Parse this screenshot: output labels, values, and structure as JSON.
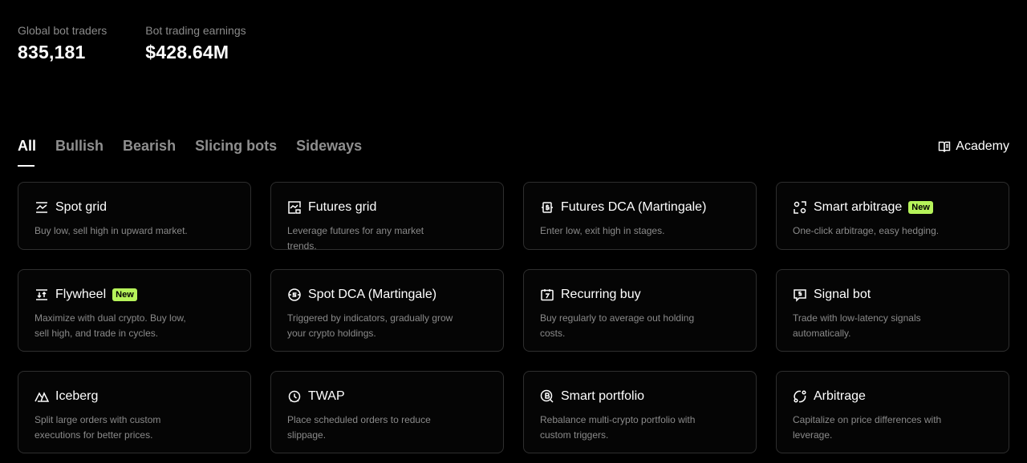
{
  "stats": [
    {
      "label": "Global bot traders",
      "value": "835,181"
    },
    {
      "label": "Bot trading earnings",
      "value": "$428.64M"
    }
  ],
  "tabs": [
    {
      "label": "All",
      "active": true
    },
    {
      "label": "Bullish",
      "active": false
    },
    {
      "label": "Bearish",
      "active": false
    },
    {
      "label": "Slicing bots",
      "active": false
    },
    {
      "label": "Sideways",
      "active": false
    }
  ],
  "academy": {
    "label": "Academy",
    "icon": "book-icon"
  },
  "badge_color": "#b6f35a",
  "cards": [
    {
      "title": "Spot grid",
      "desc": "Buy low, sell high in upward market.",
      "icon": "grid-chart-icon",
      "badge": null
    },
    {
      "title": "Futures grid",
      "desc": "Leverage futures for any market trends.",
      "icon": "futures-chart-icon",
      "badge": null
    },
    {
      "title": "Futures DCA (Martingale)",
      "desc": "Enter low, exit high in stages.",
      "icon": "dollar-cycle-icon",
      "badge": null
    },
    {
      "title": "Smart arbitrage",
      "desc": "One-click arbitrage, easy hedging.",
      "icon": "scan-circles-icon",
      "badge": "New"
    },
    {
      "title": "Flywheel",
      "desc": "Maximize with dual crypto. Buy low, sell high, and trade in cycles.",
      "icon": "up-down-arrows-icon",
      "badge": "New"
    },
    {
      "title": "Spot DCA (Martingale)",
      "desc": "Triggered by indicators, gradually grow your crypto holdings.",
      "icon": "dollar-circle-icon",
      "badge": null
    },
    {
      "title": "Recurring buy",
      "desc": "Buy regularly to average out holding costs.",
      "icon": "calendar-icon",
      "badge": null
    },
    {
      "title": "Signal bot",
      "desc": "Trade with low-latency signals automatically.",
      "icon": "signal-message-icon",
      "badge": null
    },
    {
      "title": "Iceberg",
      "desc": "Split large orders with custom executions for better prices.",
      "icon": "iceberg-icon",
      "badge": null
    },
    {
      "title": "TWAP",
      "desc": "Place scheduled orders to reduce slippage.",
      "icon": "alarm-clock-icon",
      "badge": null
    },
    {
      "title": "Smart portfolio",
      "desc": "Rebalance multi-crypto portfolio with custom triggers.",
      "icon": "bitcoin-search-icon",
      "badge": null
    },
    {
      "title": "Arbitrage",
      "desc": "Capitalize on price differences with leverage.",
      "icon": "orbit-icon",
      "badge": null
    }
  ]
}
